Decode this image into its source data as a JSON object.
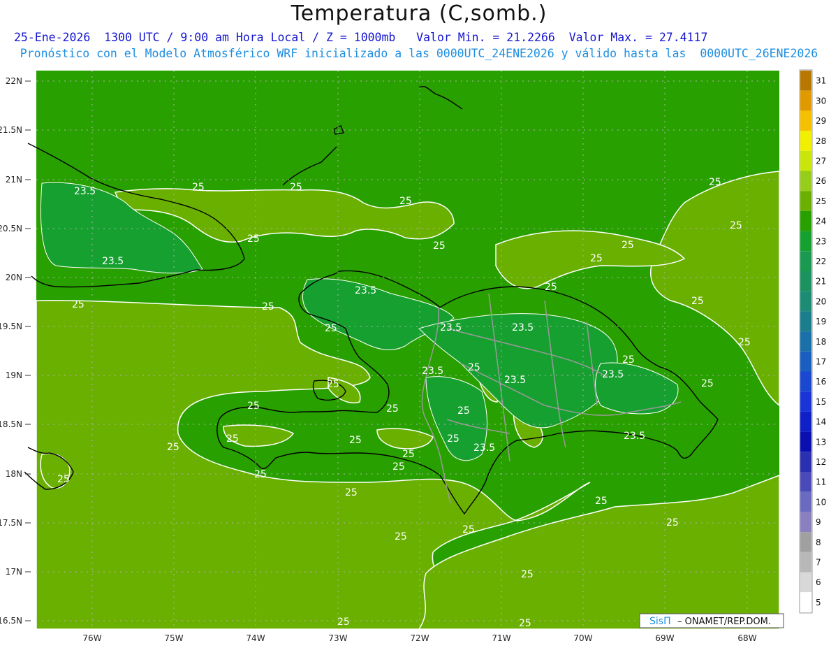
{
  "title": "Temperatura (C,somb.)",
  "subtitle_line1": "25-Ene-2026  1300 UTC / 9:00 am Hora Local / Z = 1000mb   Valor Min. = 21.2266  Valor Max. = 27.4117",
  "subtitle_line2": "Pronóstico con el Modelo Atmosférico WRF inicializado a las 0000UTC_24ENE2026 y válido hasta las  0000UTC_26ENE2026",
  "lat_labels": [
    "22N",
    "21.5N",
    "21N",
    "20.5N",
    "20N",
    "19.5N",
    "19N",
    "18.5N",
    "18N",
    "17.5N",
    "17N",
    "16.5N"
  ],
  "lon_labels": [
    "76W",
    "75W",
    "74W",
    "73W",
    "72W",
    "71W",
    "70W",
    "69W",
    "68W"
  ],
  "contour_labels": [
    "23.5",
    "25"
  ],
  "colorbar": {
    "levels": [
      "31",
      "30",
      "29",
      "28",
      "27",
      "26",
      "25",
      "24",
      "23",
      "22",
      "21",
      "20",
      "19",
      "18",
      "17",
      "16",
      "15",
      "14",
      "13",
      "12",
      "11",
      "10",
      "9",
      "8",
      "7",
      "6",
      "5"
    ],
    "colors": [
      "#b87800",
      "#e09a00",
      "#f5c000",
      "#f0f000",
      "#c9e60a",
      "#96cc1a",
      "#6ab000",
      "#28a000",
      "#16a030",
      "#1a9a50",
      "#1c9260",
      "#1d8c74",
      "#1a7e8c",
      "#1a70a8",
      "#1a5ec0",
      "#1a48d0",
      "#1a34d8",
      "#1020c8",
      "#0a10b0",
      "#2a30b0",
      "#4a4ab8",
      "#6a6ac0",
      "#8a80c0",
      "#a0a0a0",
      "#b8b8b8",
      "#d8d8d8",
      "#ffffff"
    ]
  },
  "credit": {
    "brand": "SisΠ",
    "text": " – ONAMET/REP.DOM."
  }
}
